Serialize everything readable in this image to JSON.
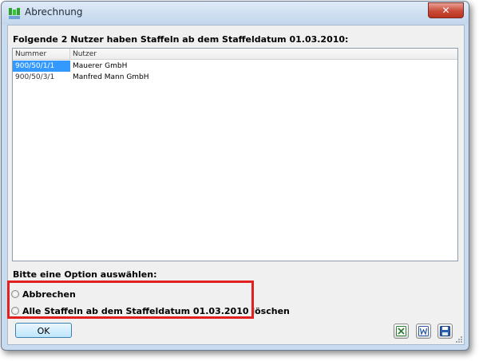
{
  "window": {
    "title": "Abrechnung",
    "close_glyph": "✕"
  },
  "main": {
    "heading": "Folgende 2 Nutzer haben Staffeln ab dem Staffeldatum 01.03.2010:",
    "columns": [
      "Nummer",
      "Nutzer"
    ],
    "rows": [
      {
        "nummer": "900/50/1/1",
        "nutzer": "Mauerer GmbH",
        "selected": true
      },
      {
        "nummer": "900/50/3/1",
        "nutzer": "Manfred Mann GmbH",
        "selected": false
      }
    ]
  },
  "options": {
    "label": "Bitte eine Option auswählen:",
    "items": [
      {
        "label": "Abbrechen",
        "selected": false
      },
      {
        "label": "Alle Staffeln ab dem Staffeldatum 01.03.2010 löschen",
        "selected": false
      }
    ]
  },
  "buttons": {
    "ok_label": "OK"
  },
  "toolbar_icons": [
    "excel-export-icon",
    "word-export-icon",
    "save-icon"
  ],
  "colors": {
    "selection": "#3399ff",
    "highlight_border": "#e32020",
    "close_button": "#c94a37"
  }
}
